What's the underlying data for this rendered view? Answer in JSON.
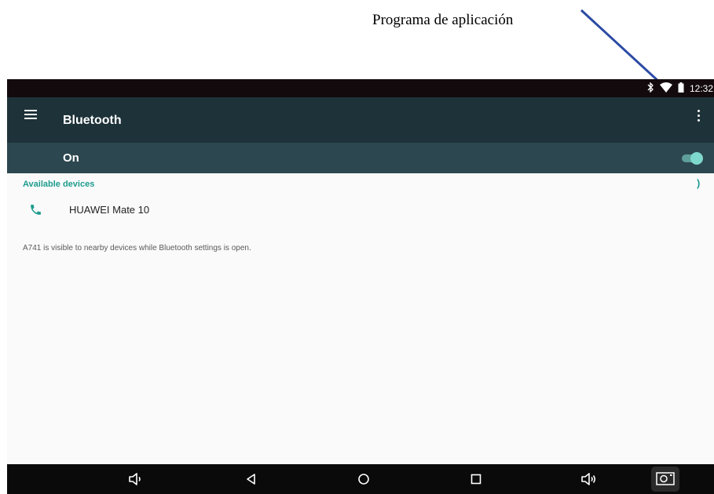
{
  "annotation": {
    "label": "Programa de aplicación",
    "arrow_color": "#2b4aa3"
  },
  "status_bar": {
    "icons": [
      "bluetooth-icon",
      "wifi-icon",
      "battery-icon"
    ],
    "time": "12:32"
  },
  "app_bar": {
    "menu_icon": "hamburger-menu-icon",
    "title": "Bluetooth",
    "overflow_icon": "more-vertical-icon"
  },
  "switch_bar": {
    "label": "On",
    "state": true
  },
  "devices_section": {
    "header": "Available devices",
    "progress_glyph": ")",
    "devices": [
      {
        "icon": "phone-icon",
        "name": "HUAWEI Mate 10"
      }
    ]
  },
  "info_text": "A741 is visible to nearby devices while Bluetooth settings is open.",
  "nav_bar": {
    "buttons": [
      "volume-down-icon",
      "back-icon",
      "home-icon",
      "recents-icon",
      "volume-up-icon",
      "screenshot-icon"
    ]
  },
  "colors": {
    "app_bar": "#1e3239",
    "switch_bar": "#2c474f",
    "accent": "#1e9c8f",
    "status_bar": "#120a0c",
    "nav_bar": "#0a0a0a"
  }
}
